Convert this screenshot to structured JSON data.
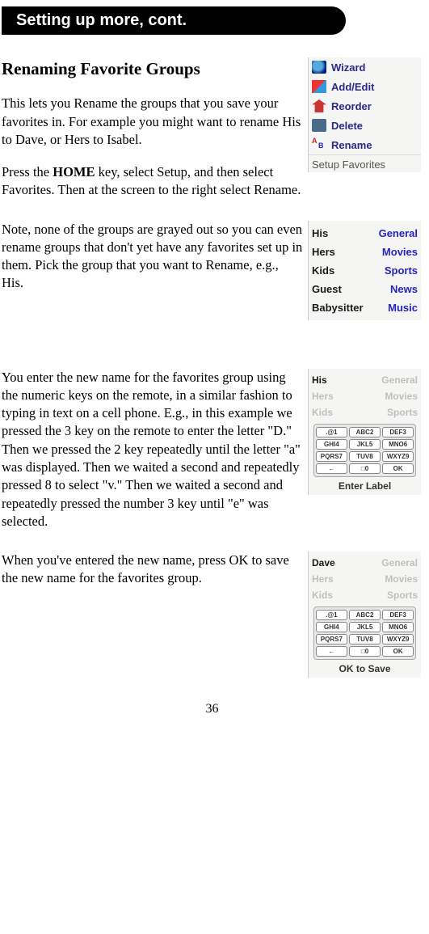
{
  "header": "Setting up more, cont.",
  "h2": "Renaming Favorite Groups",
  "p1": "This lets you Rename the groups that you save your favorites in. For example you might want to rename His to Dave, or Hers to Isabel.",
  "p2a": "Press the ",
  "p2b": "HOME",
  "p2c": " key, select Setup, and then select Favorites. Then at the screen to the right select Rename.",
  "p3": "Note, none of the groups are grayed out so you can even rename groups that don't yet have any favorites set up in them. Pick the group that you want to Rename, e.g., His.",
  "p4": "You enter the new name for the favorites group using the numeric keys on the remote, in a similar fashion to typing in text on a cell phone. E.g., in this example we pressed the 3 key on the remote to enter the letter \"D.\" Then we pressed the 2 key repeatedly until the letter \"a\" was displayed. Then we waited a second and repeatedly pressed 8 to select \"v.\" Then we waited a second and repeatedly pressed the number 3 key until \"e\" was selected.",
  "p5": "When you've entered the new name, press OK to save the new name for the favorites group.",
  "page_number": "36",
  "setup_menu": {
    "items": [
      "Wizard",
      "Add/Edit",
      "Reorder",
      "Delete",
      "Rename"
    ],
    "caption": "Setup Favorites"
  },
  "groups": {
    "left": [
      "His",
      "Hers",
      "Kids",
      "Guest",
      "Babysitter"
    ],
    "right": [
      "General",
      "Movies",
      "Sports",
      "News",
      "Music"
    ]
  },
  "enter_label": {
    "left": [
      "His",
      "Hers",
      "Kids"
    ],
    "right": [
      "General",
      "Movies",
      "Sports"
    ],
    "keys": [
      ".@1",
      "ABC2",
      "DEF3",
      "GHI4",
      "JKL5",
      "MNO6",
      "PQRS7",
      "TUV8",
      "WXYZ9",
      "←",
      "□0",
      "OK"
    ],
    "caption": "Enter Label"
  },
  "ok_save": {
    "left": [
      "Dave",
      "Hers",
      "Kids"
    ],
    "right": [
      "General",
      "Movies",
      "Sports"
    ],
    "keys": [
      ".@1",
      "ABC2",
      "DEF3",
      "GHI4",
      "JKL5",
      "MNO6",
      "PQRS7",
      "TUV8",
      "WXYZ9",
      "←",
      "□0",
      "OK"
    ],
    "caption": "OK to Save"
  }
}
